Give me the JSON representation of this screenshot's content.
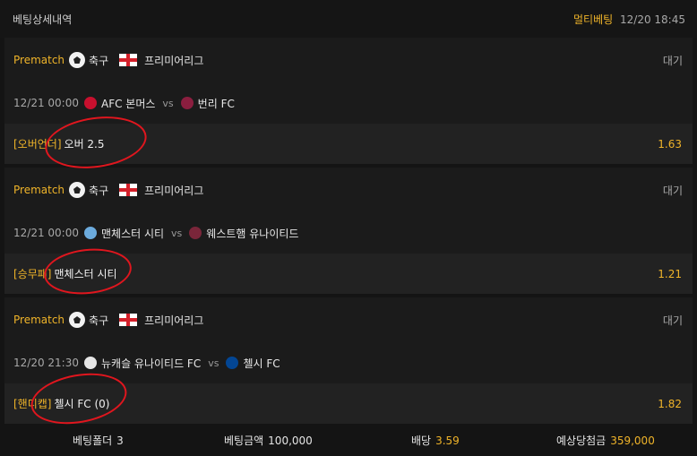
{
  "header": {
    "title": "베팅상세내역",
    "label": "멀티베팅",
    "time": "12/20 18:45"
  },
  "bets": [
    {
      "tag": "Prematch",
      "sport": "축구",
      "league": "프리미어리그",
      "status": "대기",
      "datetime": "12/21 00:00",
      "home": "AFC 본머스",
      "vs": "vs",
      "away": "번리 FC",
      "market": "[오버언더]",
      "pick": "오버 2.5",
      "odds": "1.63",
      "home_crest_color": "#c8102e",
      "away_crest_color": "#8b1e3f"
    },
    {
      "tag": "Prematch",
      "sport": "축구",
      "league": "프리미어리그",
      "status": "대기",
      "datetime": "12/21 00:00",
      "home": "맨체스터 시티",
      "vs": "vs",
      "away": "웨스트햄 유나이티드",
      "market": "[승무패]",
      "pick": "맨체스터 시티",
      "odds": "1.21",
      "home_crest_color": "#6cabdd",
      "away_crest_color": "#7a263a"
    },
    {
      "tag": "Prematch",
      "sport": "축구",
      "league": "프리미어리그",
      "status": "대기",
      "datetime": "12/20 21:30",
      "home": "뉴캐슬 유나이티드 FC",
      "vs": "vs",
      "away": "첼시 FC",
      "market": "[핸디캡]",
      "pick": "첼시 FC (0)",
      "odds": "1.82",
      "home_crest_color": "#e6e6e6",
      "away_crest_color": "#034694"
    }
  ],
  "footer": {
    "folder_label": "베팅폴더",
    "folder_value": "3",
    "amount_label": "베팅금액",
    "amount_value": "100,000",
    "odds_label": "배당",
    "odds_value": "3.59",
    "expected_label": "예상당첨금",
    "expected_value": "359,000"
  },
  "colors": {
    "accent": "#f0b429",
    "annotation": "#e0161e",
    "background": "#141414"
  }
}
